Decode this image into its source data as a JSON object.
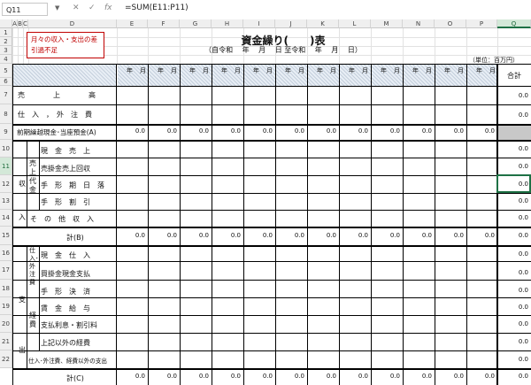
{
  "formula_bar": {
    "name_box": "Q11",
    "cancel": "✕",
    "enter": "✓",
    "fx": "fx",
    "formula": "=SUM(E11:P11)"
  },
  "columns": [
    "A",
    "B",
    "C",
    "D",
    "E",
    "F",
    "G",
    "H",
    "I",
    "J",
    "K",
    "L",
    "M",
    "N",
    "O",
    "P",
    "Q"
  ],
  "rows": [
    "1",
    "2",
    "3",
    "4",
    "5",
    "6",
    "7",
    "8",
    "9",
    "10",
    "11",
    "12",
    "13",
    "14",
    "15",
    "16",
    "17",
    "18",
    "19",
    "20",
    "21",
    "22"
  ],
  "note": "月々の収入・支出の差引過不足",
  "title": "資金繰り(　　)表",
  "period": "（自令和　 年　 月　 日 至令和　 年　 月　 日）",
  "unit": "（単位：百万円）",
  "month_header": {
    "year": "年",
    "month": "月"
  },
  "total_header": "合計",
  "labels": {
    "sales": "売　　　　上　　　　高",
    "purchases": "仕　入　，　外　注　費",
    "carryover": "前期繰越現金･当座預金(A)",
    "income_side": "収",
    "income_side2": "入",
    "sales_proceeds": "売上代金",
    "cash_sales": "現　金　売　上",
    "ar_collect": "売掛金売上回収",
    "bill_due": "手　形　期　日　落",
    "bill_discount": "手　形　割　引",
    "other_income": "そ　の　他　収　入",
    "total_b": "計(B)",
    "expense_side": "支",
    "expense_side2": "出",
    "purchase_outsource": "仕入･外注費",
    "expenses": "経費",
    "cash_purchase": "現　金　仕　入",
    "ap_payment": "買掛金現金支払",
    "bill_settle": "手　形　決　済",
    "wages": "賃　金　給　与",
    "interest": "支払利息・割引料",
    "other_expense": "上記以外の経費",
    "non_purchase": "仕入･外注費、経費以外の支出",
    "total_c": "計(C)"
  },
  "values": {
    "zero": "0.0"
  }
}
